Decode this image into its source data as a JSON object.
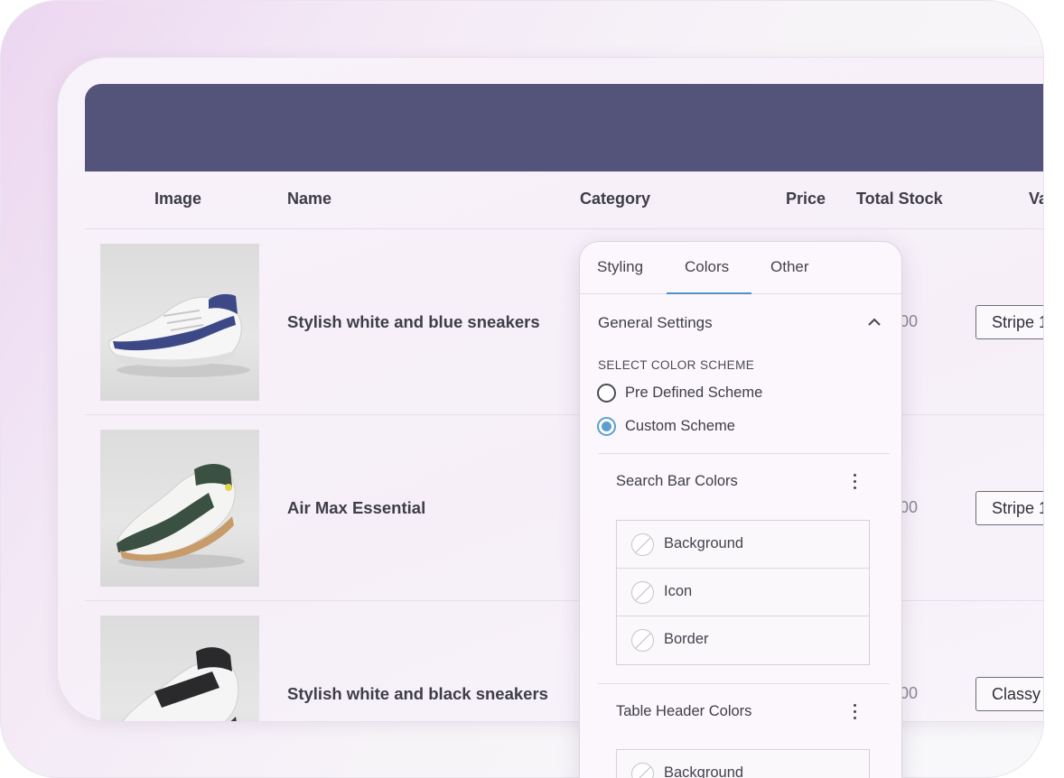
{
  "table": {
    "columns": [
      "Image",
      "Name",
      "Category",
      "Price",
      "Total Stock",
      "Va"
    ],
    "rows": [
      {
        "name": "Stylish white and blue sneakers",
        "price_peek": "00",
        "variant": "Stripe 1",
        "shoe_color": "#3d4886"
      },
      {
        "name": "Air Max Essential",
        "price_peek": "00",
        "variant": "Stripe 1",
        "shoe_color": "#3a5040"
      },
      {
        "name": "Stylish white and black sneakers",
        "price_peek": "00",
        "variant": "Classy",
        "shoe_color": "#2a2a2c"
      }
    ]
  },
  "panel": {
    "tabs": [
      "Styling",
      "Colors",
      "Other"
    ],
    "active_tab": "Colors",
    "section_title": "General Settings",
    "scheme_caption": "SELECT COLOR SCHEME",
    "scheme_options": [
      {
        "label": "Pre Defined Scheme",
        "checked": false
      },
      {
        "label": "Custom Scheme",
        "checked": true
      }
    ],
    "groups": [
      {
        "title": "Search Bar Colors",
        "items": [
          "Background",
          "Icon",
          "Border"
        ]
      },
      {
        "title": "Table Header Colors",
        "items": [
          "Background"
        ]
      }
    ]
  },
  "colors": {
    "banner": "#545379",
    "accent": "#5b9fd0"
  }
}
